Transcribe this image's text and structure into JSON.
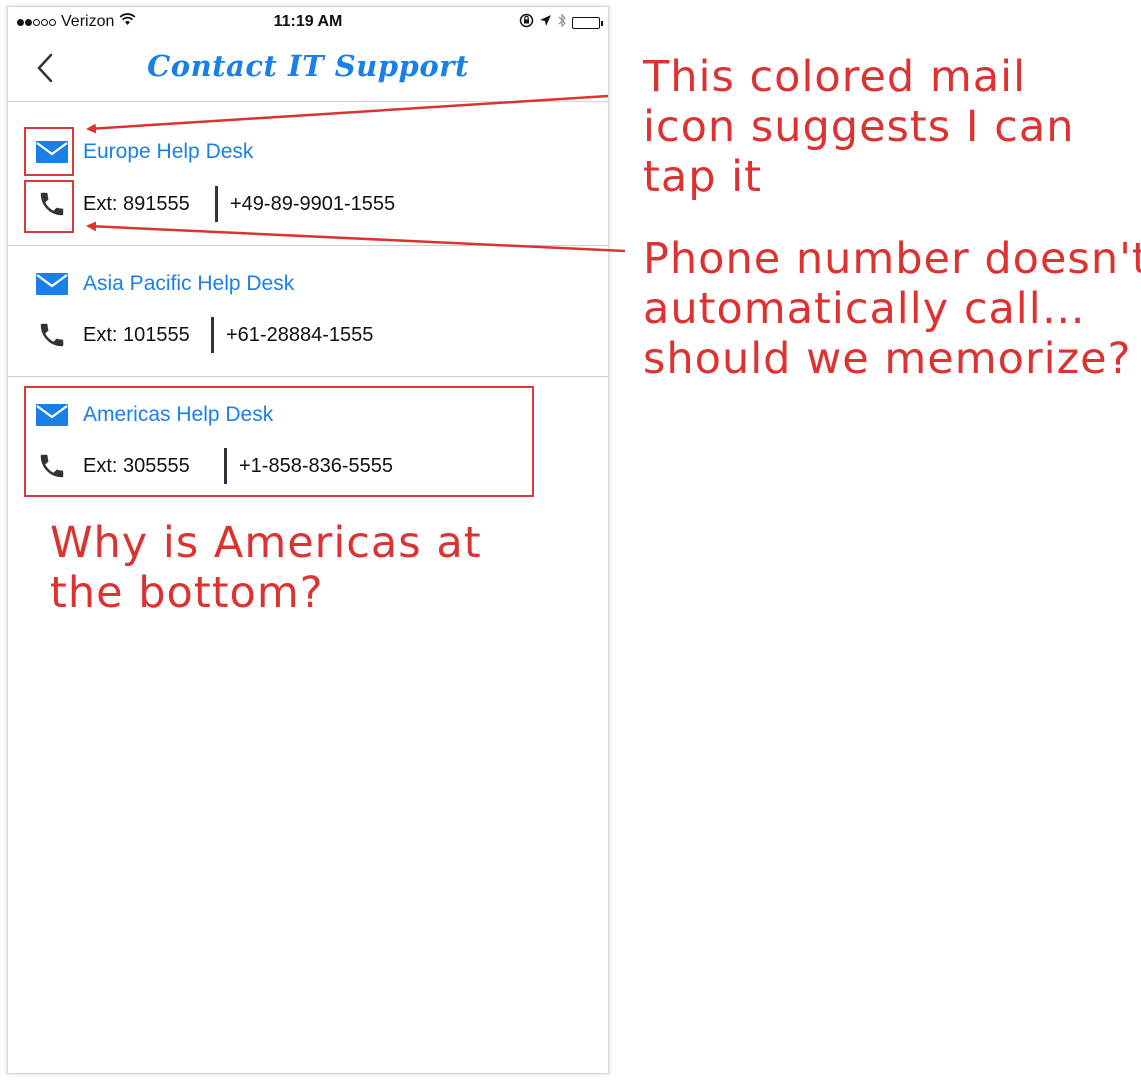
{
  "status_bar": {
    "carrier": "Verizon",
    "time": "11:19 AM"
  },
  "nav": {
    "title": "Contact IT Support"
  },
  "desks": [
    {
      "name": "Europe Help Desk",
      "ext": "Ext: 891555",
      "phone": "+49-89-9901-1555"
    },
    {
      "name": "Asia Pacific Help Desk",
      "ext": "Ext: 101555",
      "phone": "+61-28884-1555"
    },
    {
      "name": "Americas Help Desk",
      "ext": "Ext: 305555",
      "phone": "+1-858-836-5555"
    }
  ],
  "annotations": {
    "mail_note": "This colored mail\nicon suggests I can\ntap it",
    "phone_note": "Phone number doesn't\nautomatically call…\nshould we memorize?",
    "order_note": "Why is Americas at\nthe bottom?"
  },
  "colors": {
    "accent_blue": "#1a7fe6",
    "annotation_red": "#dc3232"
  },
  "icons": [
    "back-chevron-icon",
    "mail-icon",
    "phone-icon",
    "wifi-icon",
    "lock-rotation-icon",
    "location-arrow-icon",
    "bluetooth-icon",
    "battery-icon"
  ]
}
